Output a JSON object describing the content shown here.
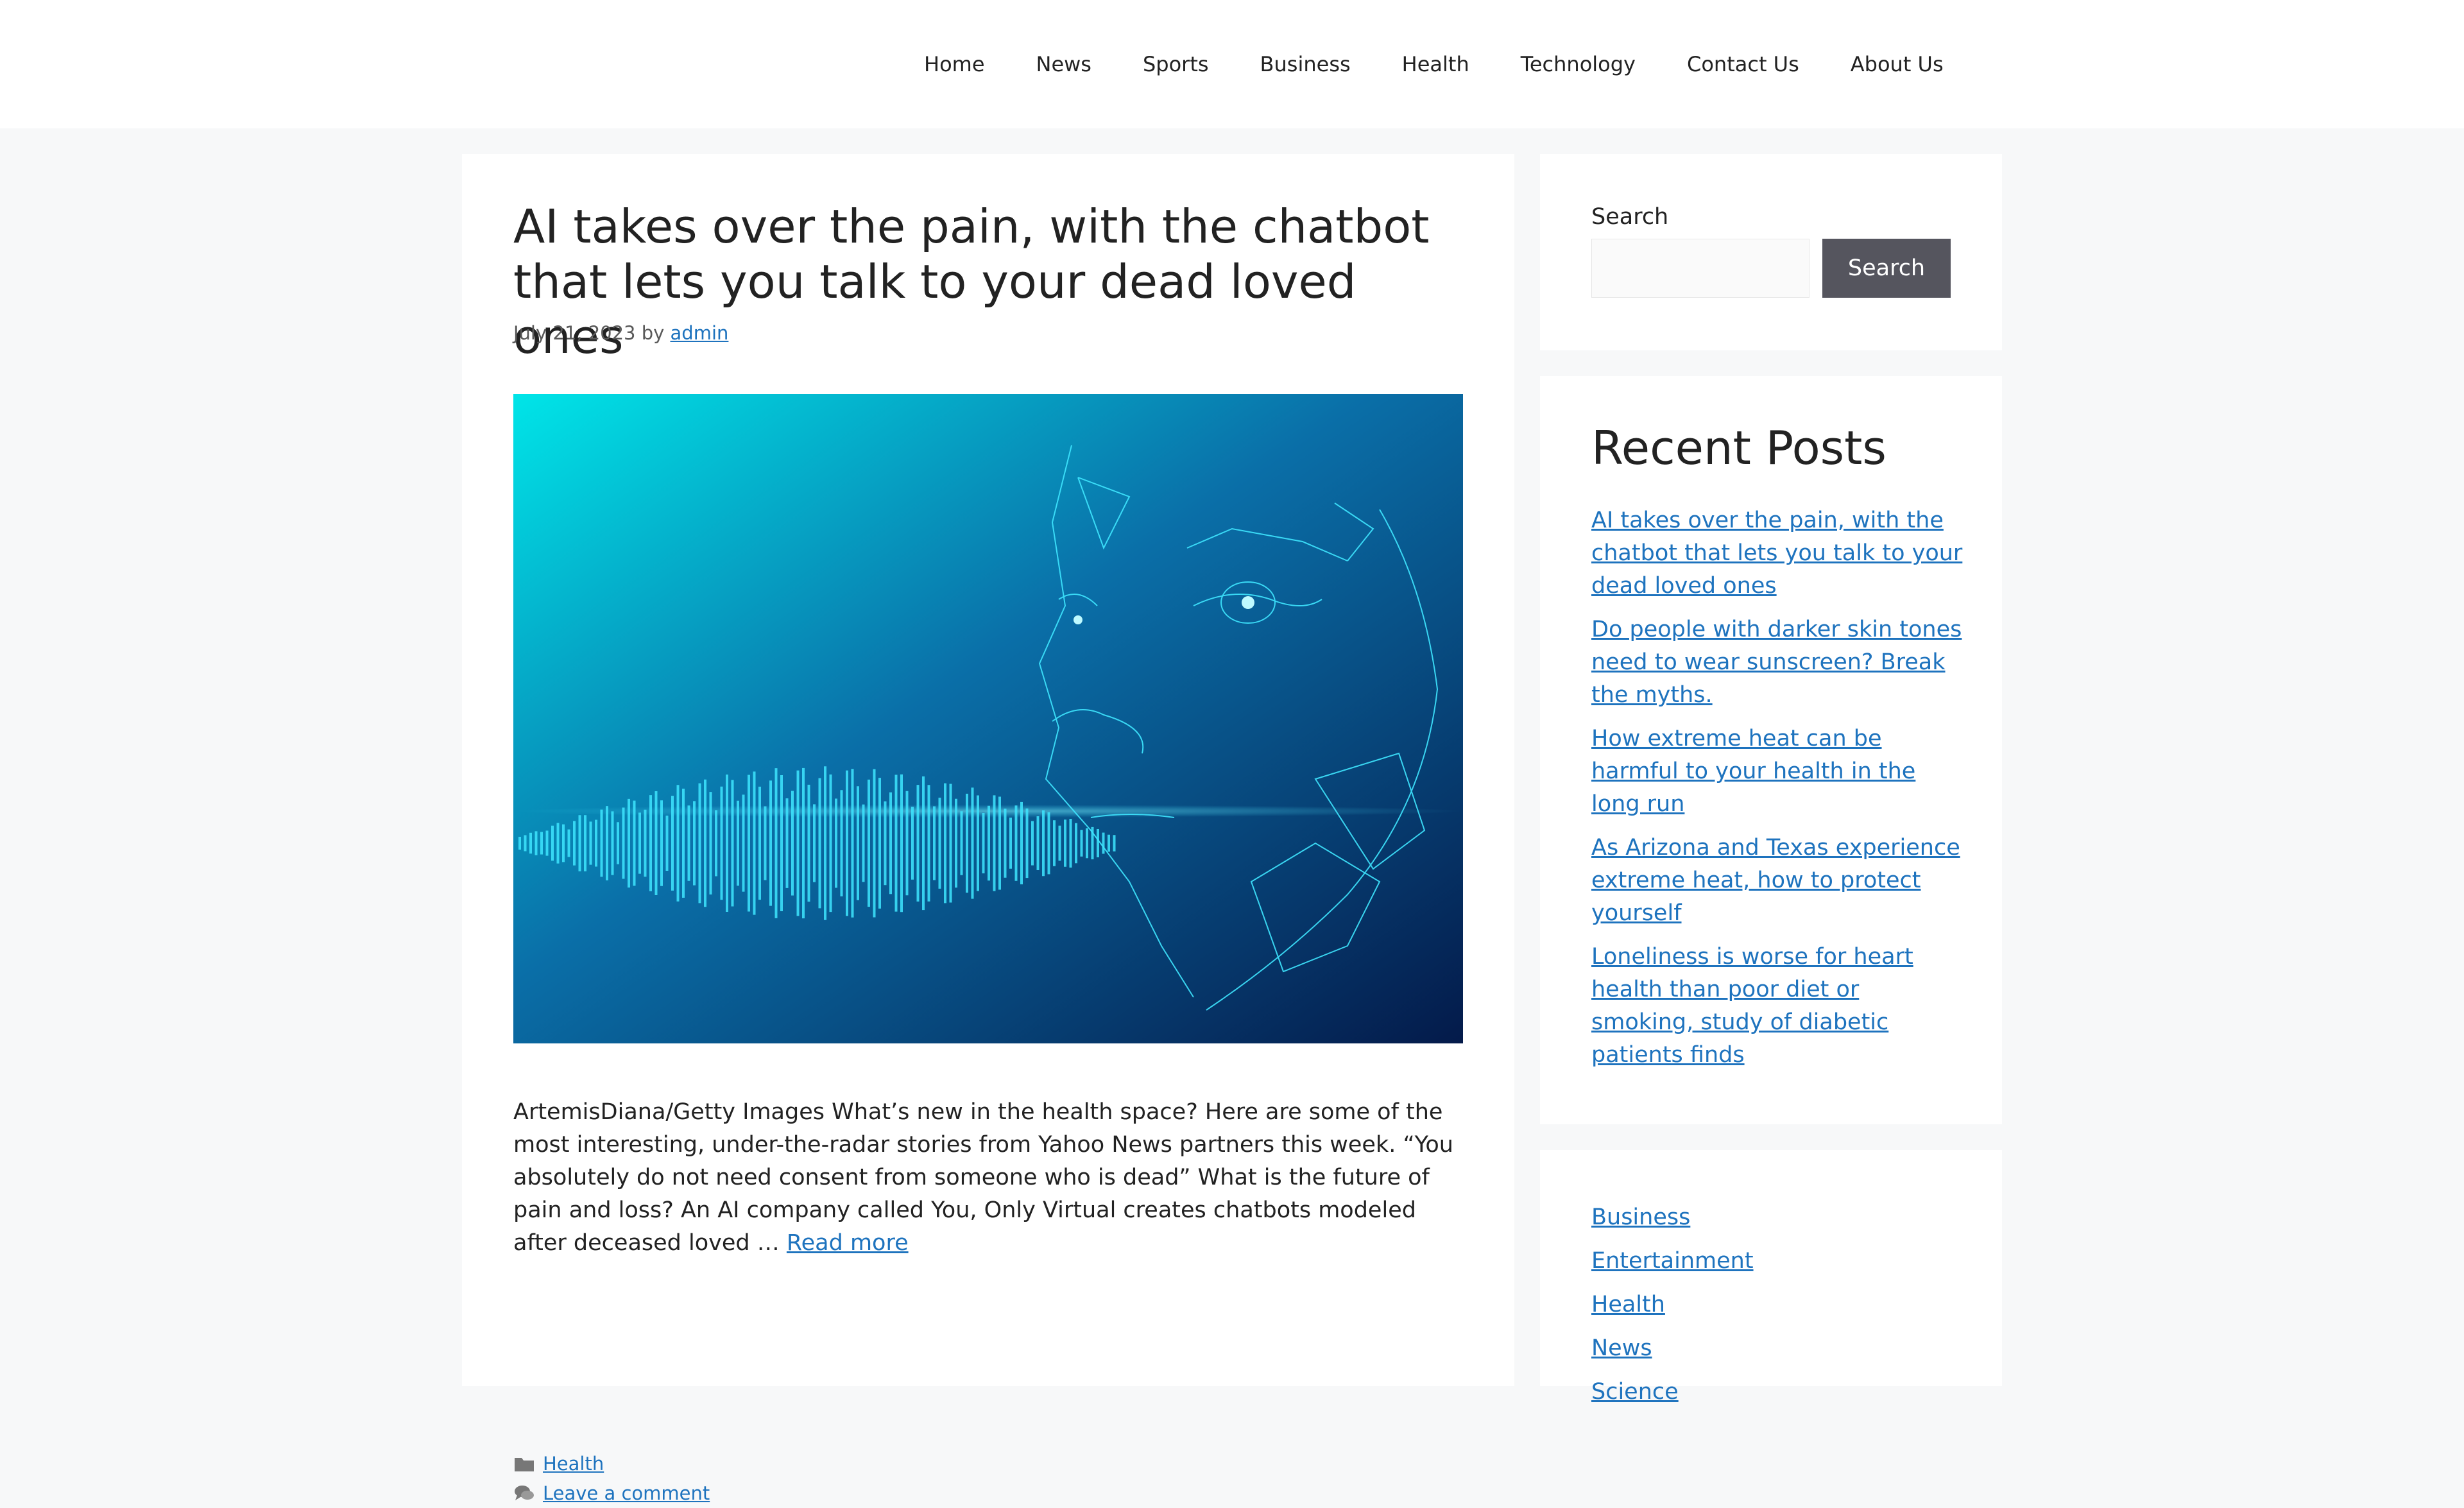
{
  "nav": {
    "items": [
      "Home",
      "News",
      "Sports",
      "Business",
      "Health",
      "Technology",
      "Contact Us",
      "About Us"
    ]
  },
  "article": {
    "title": "AI takes over the pain, with the chatbot that lets you talk to your dead loved ones",
    "date": "July 21, 2023",
    "by": "by",
    "author": "admin",
    "excerpt": "ArtemisDiana/Getty Images What’s new in the health space? Here are some of the most interesting, under-the-radar stories from Yahoo News partners this week. “You absolutely do not need consent from someone who is dead” What is the future of pain and loss? An AI company called You, Only Virtual creates chatbots modeled after deceased loved …",
    "read_more": "Read more",
    "category": "Health",
    "comment_link": "Leave a comment",
    "image_colors": {
      "top_left": "#00e5e8",
      "mid": "#0a6fa8",
      "bottom_right": "#041a4a",
      "accent": "#3fe6ff"
    }
  },
  "sidebar": {
    "search": {
      "label": "Search",
      "button": "Search",
      "value": ""
    },
    "recent_posts": {
      "title": "Recent Posts",
      "items": [
        "AI takes over the pain, with the chatbot that lets you talk to your dead loved ones",
        "Do people with darker skin tones need to wear sunscreen? Break the myths.",
        "How extreme heat can be harmful to your health in the long run",
        "As Arizona and Texas experience extreme heat, how to protect yourself",
        "Loneliness is worse for heart health than poor diet or smoking, study of diabetic patients finds"
      ]
    },
    "categories": {
      "items": [
        "Business",
        "Entertainment",
        "Health",
        "News",
        "Science"
      ]
    }
  }
}
